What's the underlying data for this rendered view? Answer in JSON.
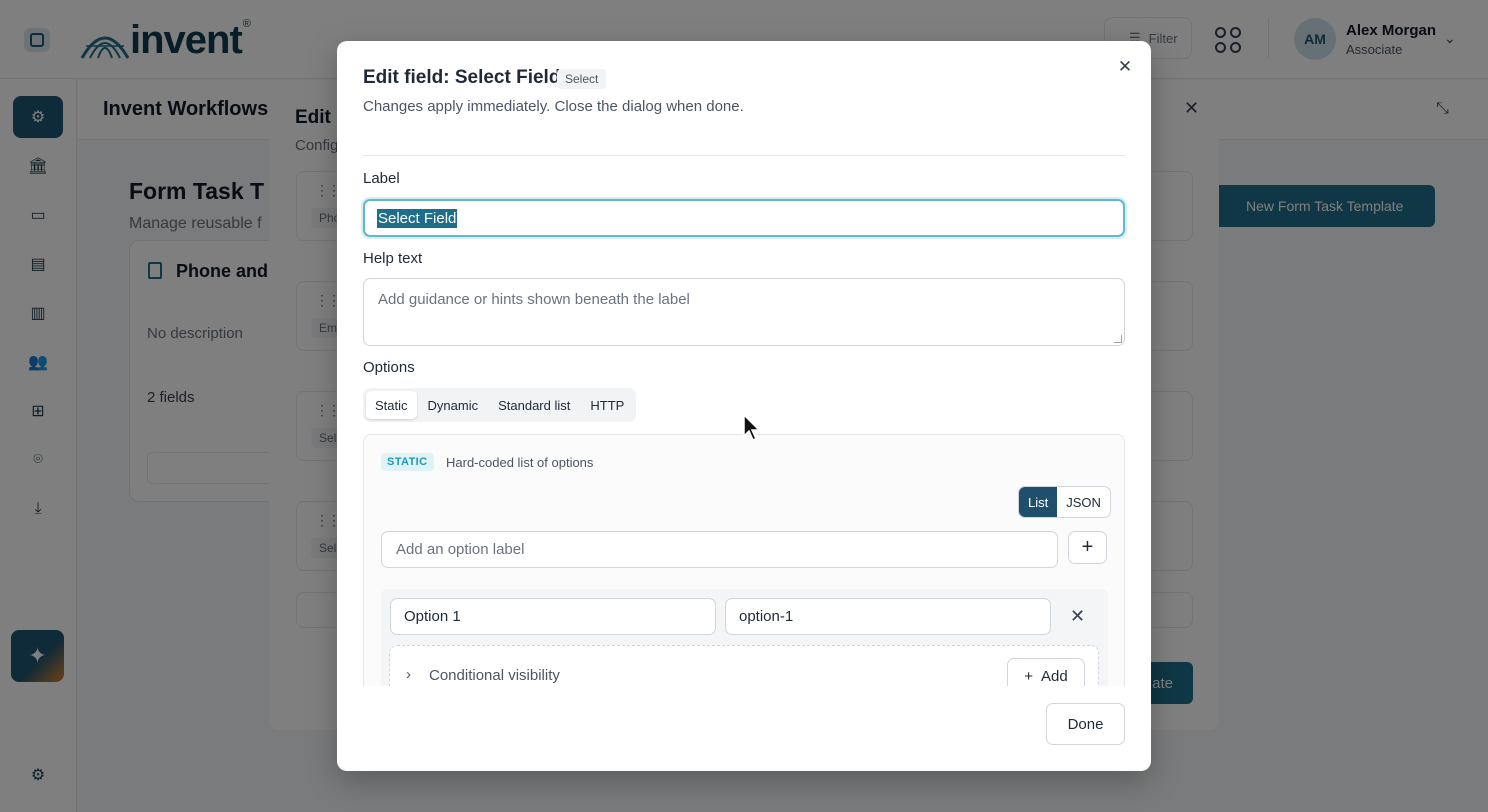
{
  "app": {
    "brand": "invent",
    "brand_mark": "®",
    "filter_label": "Filter",
    "user": {
      "initials": "AM",
      "name": "Alex Morgan",
      "role": "Associate"
    }
  },
  "sidebar": {
    "items": [
      {
        "icon": "gear-icon",
        "active": true
      },
      {
        "icon": "bank-icon"
      },
      {
        "icon": "folder-icon"
      },
      {
        "icon": "library-icon"
      },
      {
        "icon": "building-icon"
      },
      {
        "icon": "users-icon"
      },
      {
        "icon": "hierarchy-icon"
      },
      {
        "icon": "location-icon"
      },
      {
        "icon": "download-icon"
      }
    ],
    "ai_icon": "sparkles-icon",
    "settings_icon": "gear-icon"
  },
  "background": {
    "page_title": "Invent Workflows",
    "section_title": "Form Task T",
    "section_subtitle": "Manage reusable f",
    "new_button": "New Form Task Template",
    "card": {
      "title": "Phone and",
      "description": "No description",
      "fields": "2 fields"
    },
    "dialog": {
      "title": "Edit I",
      "subtitle": "Config",
      "rows": [
        "Pho",
        "Em",
        "Sel",
        "Sel"
      ],
      "save_label": "ate"
    }
  },
  "modal": {
    "title": "Edit field: Select Field",
    "type_badge": "Select",
    "description": "Changes apply immediately. Close the dialog when done.",
    "label_caption": "Label",
    "label_value": "Select Field",
    "help_caption": "Help text",
    "help_placeholder": "Add guidance or hints shown beneath the label",
    "options_caption": "Options",
    "option_sources": [
      "Static",
      "Dynamic",
      "Standard list",
      "HTTP"
    ],
    "active_source": "Static",
    "static": {
      "badge": "STATIC",
      "description": "Hard-coded list of options",
      "modes": [
        "List",
        "JSON"
      ],
      "active_mode": "List",
      "add_placeholder": "Add an option label",
      "options": [
        {
          "label": "Option 1",
          "value": "option-1"
        }
      ],
      "conditional_label": "Conditional visibility",
      "conditional_add": "Add"
    },
    "done_label": "Done"
  },
  "colors": {
    "primary": "#1e5470",
    "accent": "#1e6e8a",
    "focus_ring": "#5fb8cf",
    "static_badge": "#1e9ab5"
  }
}
